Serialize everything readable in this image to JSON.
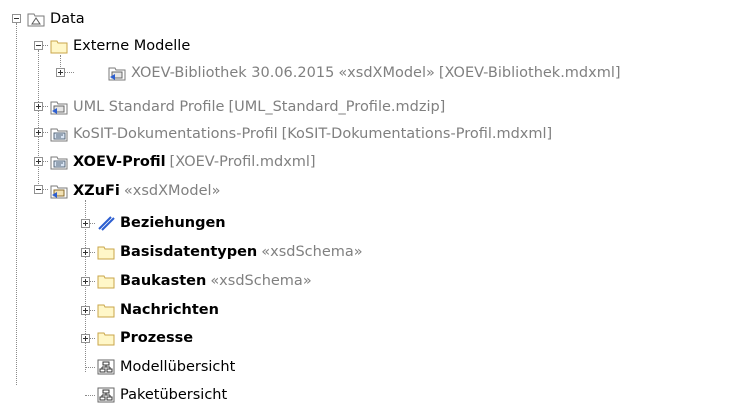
{
  "tree": {
    "root": {
      "label": "Data",
      "icon": "package-icon"
    },
    "externe_modelle": {
      "label": "Externe Modelle",
      "icon": "folder-icon"
    },
    "xoev_bibliothek": {
      "label": "XOEV-Bibliothek 30.06.2015",
      "stereotype": "«xsdXModel»",
      "file": "[XOEV-Bibliothek.mdxml]",
      "icon": "shared-model-icon"
    },
    "uml_standard": {
      "label": "UML Standard Profile",
      "file": "[UML_Standard_Profile.mdzip]",
      "icon": "shared-model-icon"
    },
    "kosit": {
      "label": "KoSIT-Dokumentations-Profil",
      "file": "[KoSIT-Dokumentations-Profil.mdxml]",
      "icon": "profile-icon"
    },
    "xoev_profil": {
      "label": "XOEV-Profil",
      "file": "[XOEV-Profil.mdxml]",
      "icon": "profile-icon"
    },
    "xzufi": {
      "label": "XZuFi",
      "stereotype": "«xsdXModel»",
      "icon": "model-icon"
    },
    "beziehungen": {
      "label": "Beziehungen",
      "icon": "relations-icon"
    },
    "basisdatentypen": {
      "label": "Basisdatentypen",
      "stereotype": "«xsdSchema»",
      "icon": "folder-icon"
    },
    "baukasten": {
      "label": "Baukasten",
      "stereotype": "«xsdSchema»",
      "icon": "folder-icon"
    },
    "nachrichten": {
      "label": "Nachrichten",
      "icon": "folder-icon"
    },
    "prozesse": {
      "label": "Prozesse",
      "icon": "folder-icon"
    },
    "modelluebersicht": {
      "label": "Modellübersicht",
      "icon": "diagram-icon"
    },
    "paketuebersicht": {
      "label": "Paketübersicht",
      "icon": "diagram-icon"
    }
  },
  "colors": {
    "grey_text": "#808080",
    "folder_fill": "#fff7c8",
    "folder_stroke": "#c9a64a",
    "relations_blue": "#2d5fd0"
  }
}
